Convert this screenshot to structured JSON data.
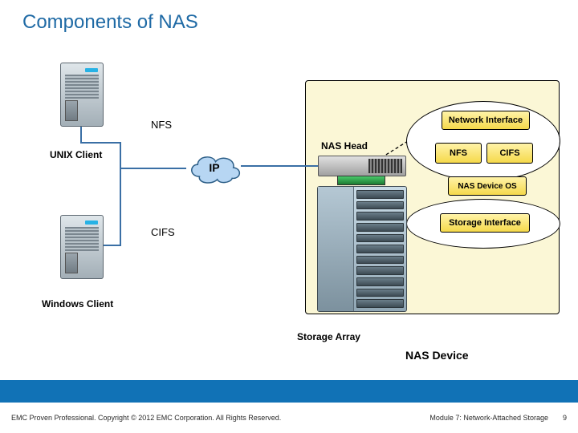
{
  "title": "Components of NAS",
  "clients": {
    "unix_label": "UNIX  Client",
    "windows_label": "Windows Client"
  },
  "protocols": {
    "nfs": "NFS",
    "cifs": "CIFS"
  },
  "cloud": {
    "label": "IP"
  },
  "nas": {
    "head_label": "NAS Head",
    "array_label": "Storage Array",
    "device_label": "NAS Device"
  },
  "features": {
    "network_interface": "Network Interface",
    "nfs": "NFS",
    "cifs": "CIFS",
    "os": "NAS Device OS",
    "storage_interface": "Storage Interface"
  },
  "footer": {
    "left": "EMC Proven Professional. Copyright © 2012 EMC Corporation. All Rights Reserved.",
    "module": "Module 7: Network-Attached Storage",
    "page": "9"
  }
}
